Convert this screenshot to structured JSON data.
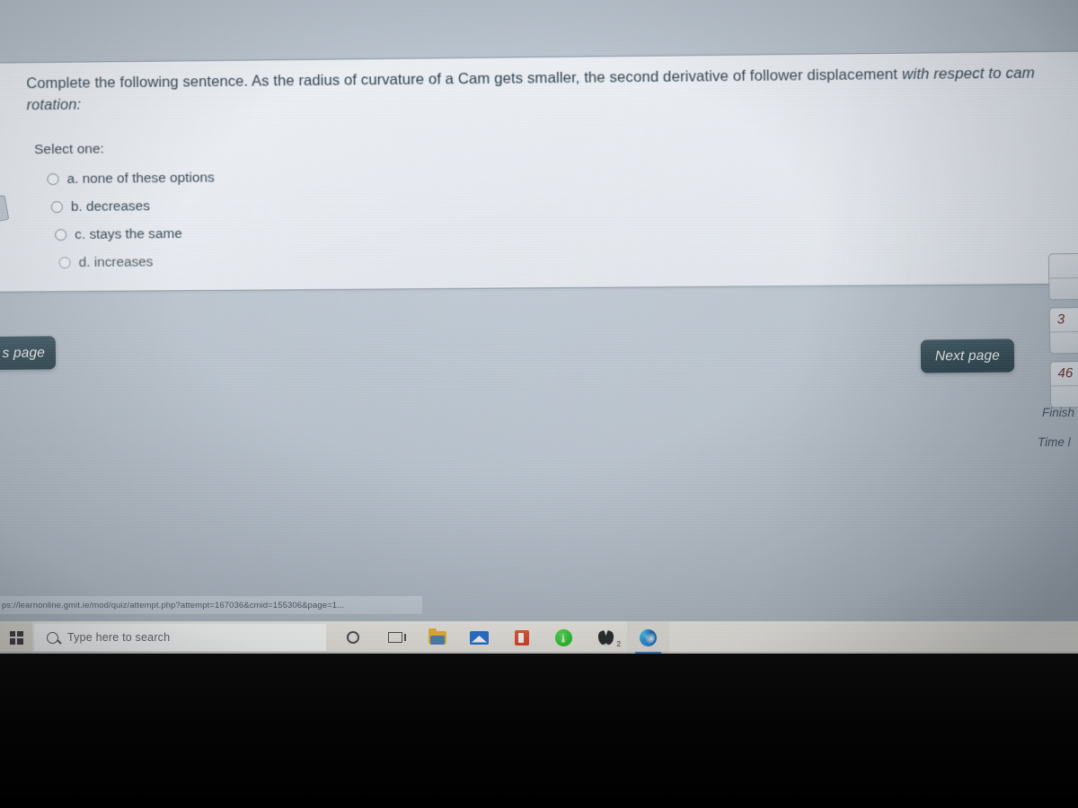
{
  "question": {
    "text_part1": "Complete the following sentence. As the radius of curvature of a Cam gets smaller, the second derivative of follower displacement ",
    "text_part2": "with respect to cam rotation:",
    "select_prompt": "Select one:",
    "options": [
      {
        "label": "a. none of these options"
      },
      {
        "label": "b. decreases"
      },
      {
        "label": "c. stays the same"
      },
      {
        "label": "d. increases"
      }
    ]
  },
  "navigation": {
    "previous_page_label": "s page",
    "next_page_label": "Next page"
  },
  "quiz_nav": {
    "cells": [
      {
        "number": ""
      },
      {
        "number": "3"
      },
      {
        "number": "46"
      }
    ],
    "finish_attempt_label": "Finish",
    "time_left_label": "Time l"
  },
  "browser": {
    "status_url": "ps://learnonline.gmit.ie/mod/quiz/attempt.php?attempt=167036&cmid=155306&page=1..."
  },
  "taskbar": {
    "search_placeholder": "Type here to search",
    "icons": [
      {
        "name": "cortana-icon"
      },
      {
        "name": "task-view-icon"
      },
      {
        "name": "file-explorer-icon"
      },
      {
        "name": "mail-icon"
      },
      {
        "name": "office-icon"
      },
      {
        "name": "green-app-icon"
      },
      {
        "name": "xbox-icon",
        "badge": "2"
      },
      {
        "name": "microsoft-edge-icon"
      }
    ]
  },
  "colors": {
    "screen_background": "#b8c2cc",
    "card_background": "#e8ebf0",
    "button_dark": "#2e4650",
    "text_primary": "#2b3a47",
    "nav_number": "#6b2b2b",
    "edge_accent": "#1b74d4"
  }
}
